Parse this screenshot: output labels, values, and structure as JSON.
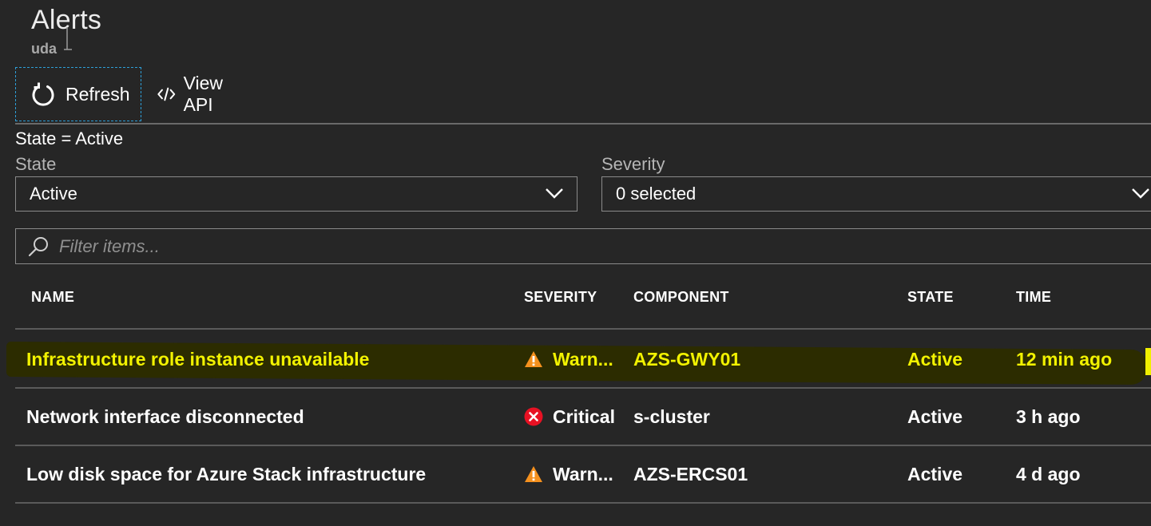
{
  "blade": {
    "title": "Alerts",
    "subtitle": "uda"
  },
  "toolbar": {
    "refresh_label": "Refresh",
    "view_api_label": "View API"
  },
  "filters": {
    "summary": "State = Active",
    "state": {
      "label": "State",
      "value": "Active"
    },
    "severity": {
      "label": "Severity",
      "value": "0 selected"
    },
    "search_placeholder": "Filter items..."
  },
  "table": {
    "columns": [
      "NAME",
      "SEVERITY",
      "COMPONENT",
      "STATE",
      "TIME"
    ],
    "rows": [
      {
        "name": "Infrastructure role instance unavailable",
        "severity": "Warn...",
        "severity_icon": "warning-icon",
        "component": "AZS-GWY01",
        "state": "Active",
        "time": "12 min ago",
        "highlighted": true
      },
      {
        "name": "Network interface disconnected",
        "severity": "Critical",
        "severity_icon": "critical-icon",
        "component": "s-cluster",
        "state": "Active",
        "time": "3 h ago",
        "highlighted": false
      },
      {
        "name": "Low disk space for Azure Stack infrastructure",
        "severity": "Warn...",
        "severity_icon": "warning-icon",
        "component": "AZS-ERCS01",
        "state": "Active",
        "time": "4 d ago",
        "highlighted": false
      }
    ]
  },
  "colors": {
    "background": "#262626",
    "focus_outline": "#2e9fd8",
    "warning": "#f5911e",
    "critical": "#e81123",
    "highlight_text": "#f2f200",
    "highlight_band": "#2c2c00"
  }
}
